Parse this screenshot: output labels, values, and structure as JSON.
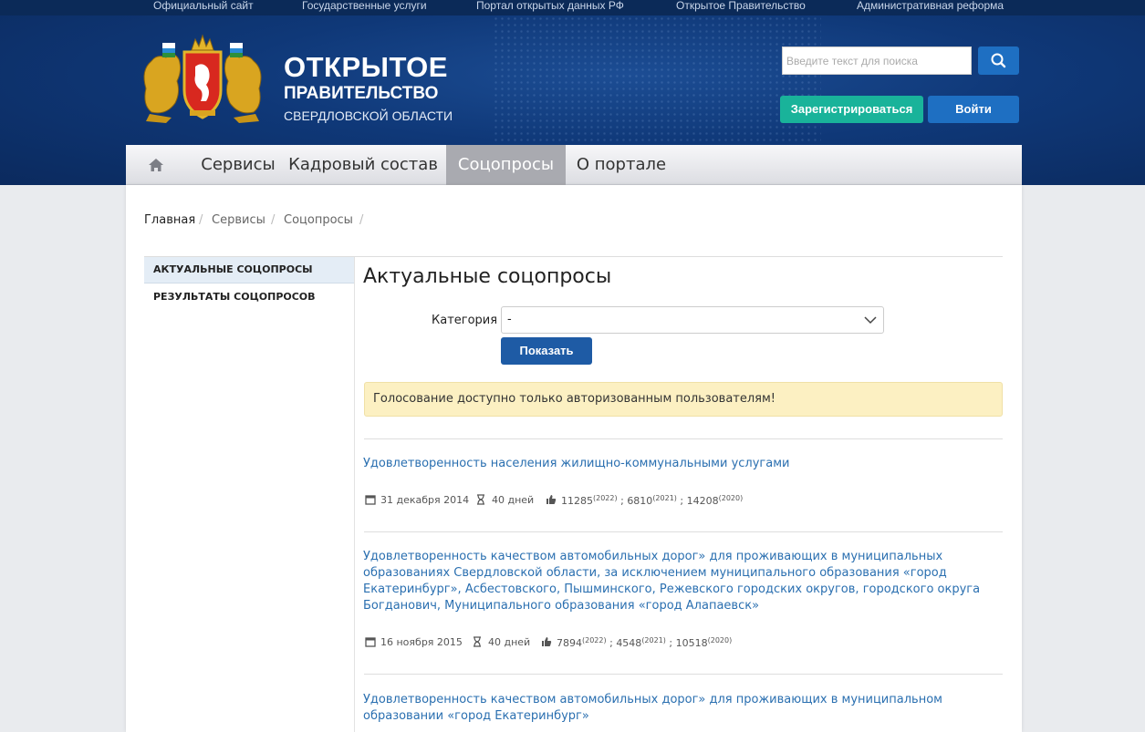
{
  "top_links": [
    "Официальный сайт",
    "Государственные услуги",
    "Портал открытых данных РФ",
    "Открытое Правительство",
    "Административная реформа"
  ],
  "brand": {
    "line1": "ОТКРЫТОЕ",
    "line2": "ПРАВИТЕЛЬСТВО",
    "line3": "СВЕРДЛОВСКОЙ ОБЛАСТИ"
  },
  "search": {
    "placeholder": "Введите текст для поиска",
    "value": ""
  },
  "auth": {
    "register": "Зарегистрироваться",
    "login": "Войти"
  },
  "nav": {
    "items": [
      "Сервисы",
      "Кадровый состав",
      "Соцопросы",
      "О портале"
    ],
    "active": "Соцопросы"
  },
  "breadcrumb": [
    "Главная",
    "Сервисы",
    "Соцопросы"
  ],
  "sidebar": {
    "items": [
      "АКТУАЛЬНЫЕ СОЦОПРОСЫ",
      "РЕЗУЛЬТАТЫ СОЦОПРОСОВ"
    ],
    "active": "АКТУАЛЬНЫЕ СОЦОПРОСЫ"
  },
  "main": {
    "title": "Актуальные соцопросы",
    "category_label": "Категория",
    "category_value": "-",
    "show_button": "Показать",
    "notice": "Голосование доступно только авторизованным пользователям!"
  },
  "polls": [
    {
      "title": "Удовлетворенность населения жилищно-коммунальными услугами",
      "date": "31 декабря 2014",
      "duration": "40 дней",
      "votes": [
        [
          "11285",
          "(2022)"
        ],
        [
          "6810",
          "(2021)"
        ],
        [
          "14208",
          "(2020)"
        ]
      ]
    },
    {
      "title": "Удовлетворенность качеством автомобильных дорог» для проживающих в муниципальных образованиях Свердловской области, за исключением муниципального образования «город Екатеринбург», Асбестовского, Пышминского, Режевского городских округов, городского округа Богданович, Муниципального образования «город Алапаевск»",
      "date": "16 ноября 2015",
      "duration": "40 дней",
      "votes": [
        [
          "7894",
          "(2022)"
        ],
        [
          "4548",
          "(2021)"
        ],
        [
          "10518",
          "(2020)"
        ]
      ]
    },
    {
      "title": "Удовлетворенность качеством автомобильных дорог» для проживающих в муниципальном образовании «город Екатеринбург»"
    }
  ],
  "colors": {
    "header_bg": "#0f3878",
    "register_btn": "#19b39a",
    "login_btn": "#1e6fc2",
    "link": "#2a6fb0",
    "notice_bg": "#fcf0c2"
  }
}
